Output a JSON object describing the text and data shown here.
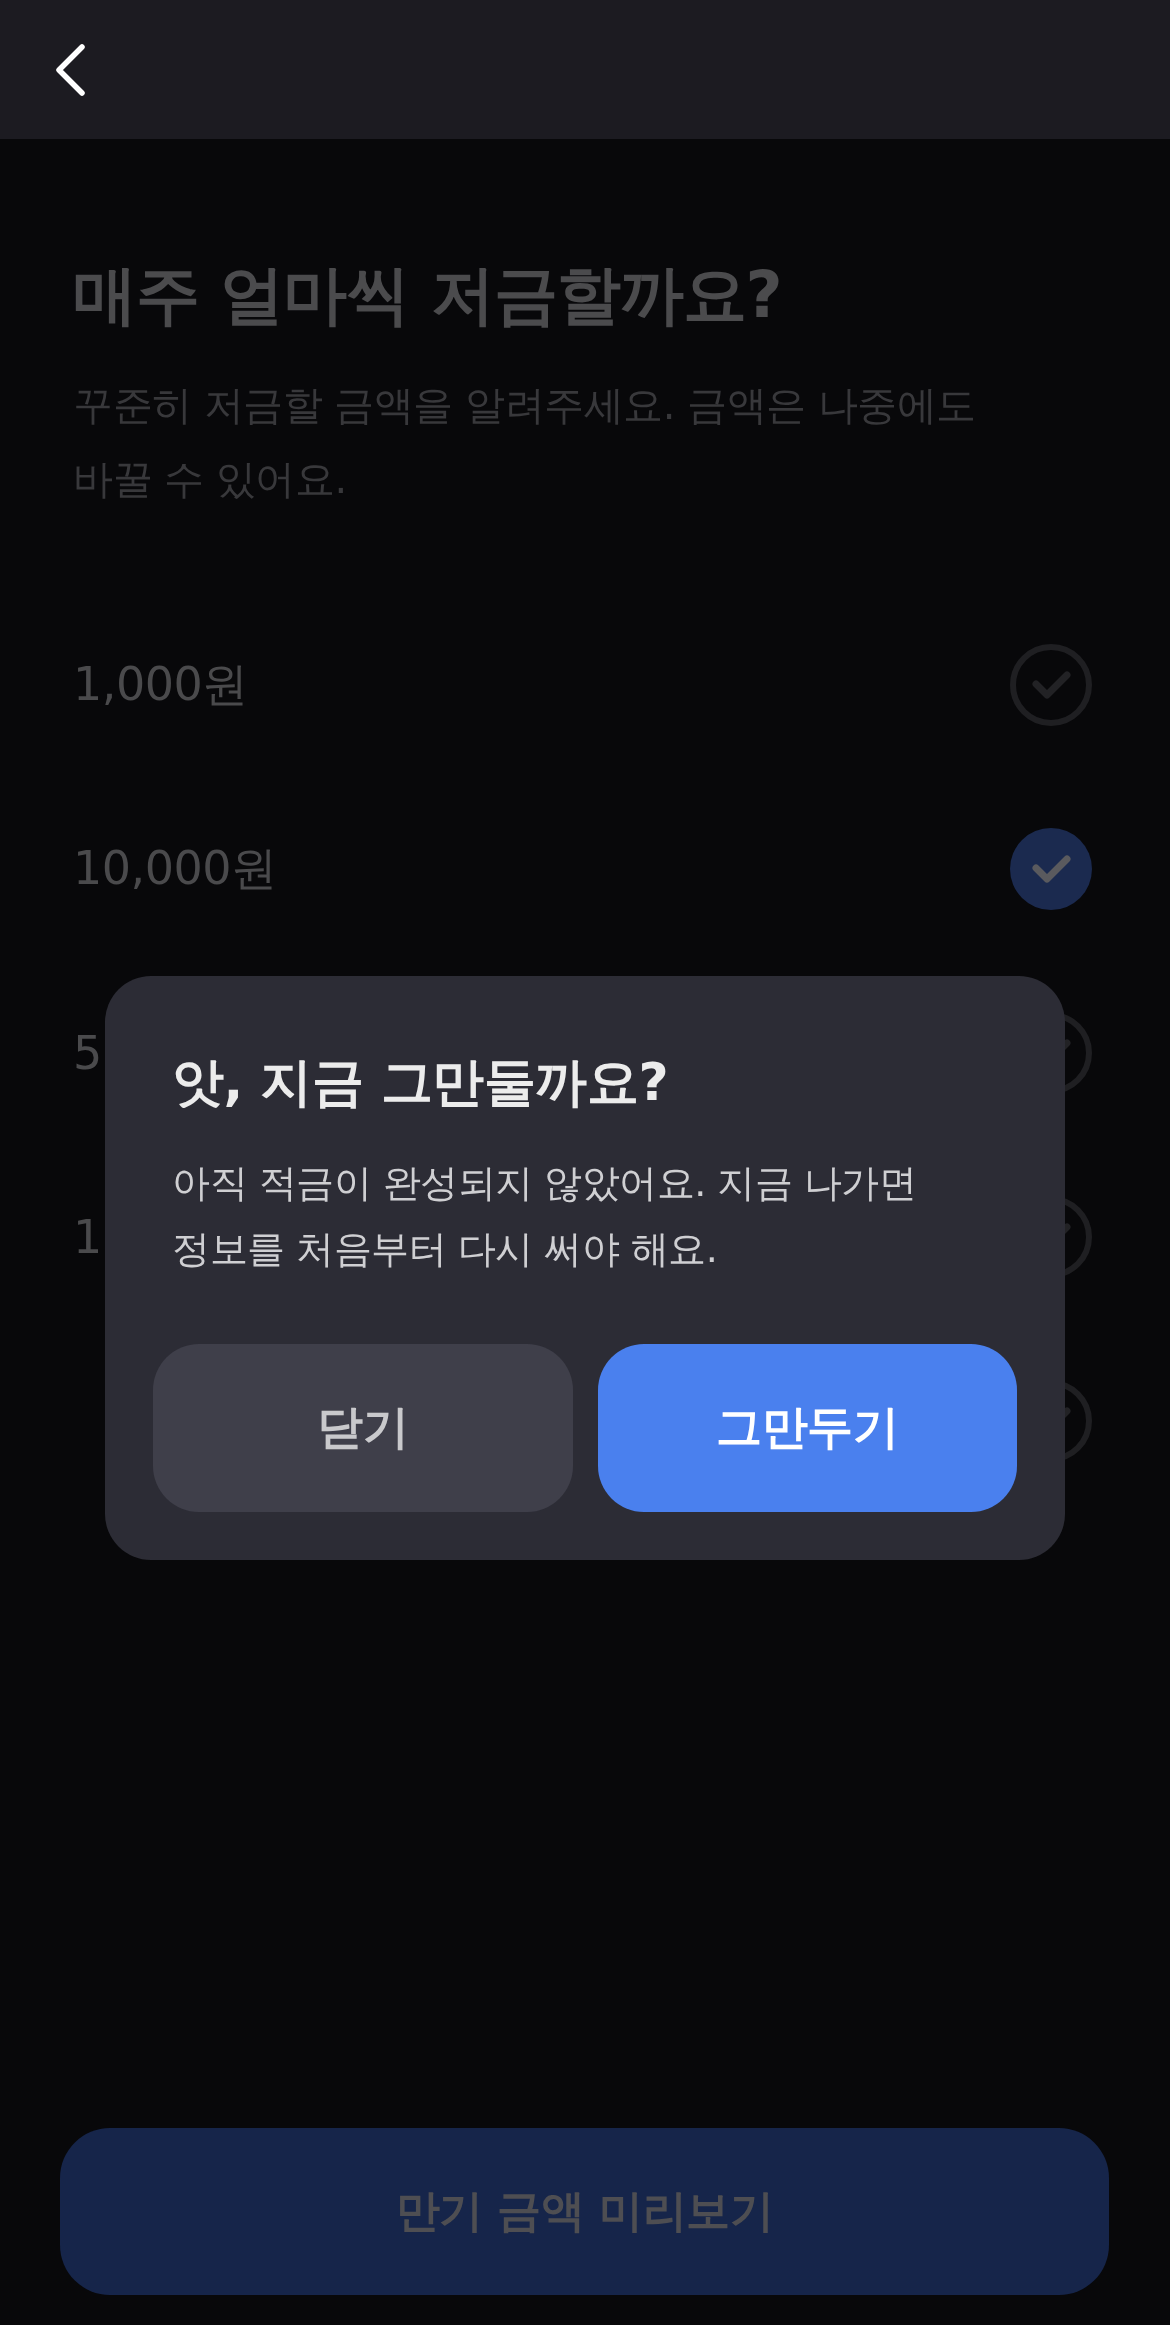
{
  "header": {
    "title": "매주 얼마씩 저금할까요?",
    "subtitle": "꾸준히 저금할 금액을 알려주세요. 금액은 나중에도 바꿀 수 있어요."
  },
  "options": [
    {
      "label": "1,000원",
      "selected": false
    },
    {
      "label": "10,000원",
      "selected": true
    },
    {
      "label": "5",
      "selected": false
    },
    {
      "label": "1",
      "selected": false
    },
    {
      "selected": false
    }
  ],
  "dialog": {
    "title": "앗, 지금 그만둘까요?",
    "message": "아직 적금이 완성되지 않았어요. 지금 나가면 정보를 처음부터 다시 써야 해요.",
    "buttons": [
      {
        "label": "닫기",
        "kind": "secondary"
      },
      {
        "label": "그만두기",
        "kind": "primary"
      }
    ]
  },
  "bottom_button": {
    "label": "만기 금액 미리보기"
  }
}
